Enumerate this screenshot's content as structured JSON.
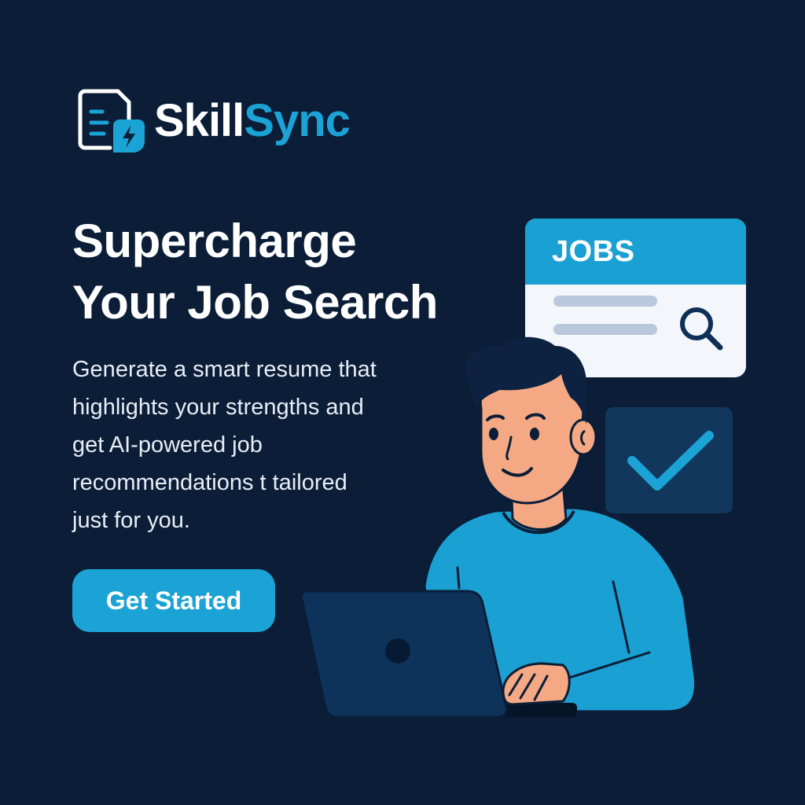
{
  "brand": {
    "name_part1": "Skill",
    "name_part2": "Sync",
    "logo_icon": "document-bolt-icon"
  },
  "hero": {
    "headline_line1": "Supercharge",
    "headline_line2": "Your Job Search",
    "description_lines": [
      "Generate a smart resume that",
      "highlights your strengths and",
      "get AI-powered job",
      "recommendations t tailored",
      "just for you."
    ],
    "cta_label": "Get Started"
  },
  "jobs_card": {
    "title": "JOBS",
    "icon": "search-icon"
  },
  "check_card": {
    "icon": "checkmark-icon"
  },
  "colors": {
    "background": "#0b1d37",
    "accent": "#1aa3d4",
    "text": "#ffffff",
    "card_dark": "#11375d",
    "skin": "#f4a984",
    "hair": "#0c2240"
  }
}
